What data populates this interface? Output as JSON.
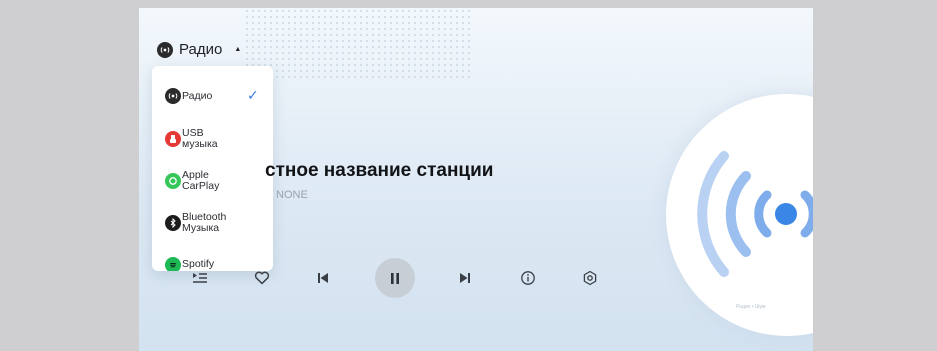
{
  "source_selector": {
    "label": "Радио",
    "icon": "radio-icon"
  },
  "dropdown": {
    "items": [
      {
        "label": "Радио",
        "icon": "radio-icon",
        "icon_color": "#2b2b2b",
        "selected": true
      },
      {
        "label": "USB\nмузыка",
        "icon": "usb-icon",
        "icon_color": "#e53935",
        "selected": false
      },
      {
        "label": "Apple\nCarPlay",
        "icon": "carplay-icon",
        "icon_color": "#35c759",
        "selected": false
      },
      {
        "label": "Bluetooth\nМузыка",
        "icon": "bluetooth-icon",
        "icon_color": "#1c1c1c",
        "selected": false
      },
      {
        "label": "Spotify",
        "icon": "spotify-icon",
        "icon_color": "#1db954",
        "selected": false
      }
    ],
    "check_mark": "✓"
  },
  "station": {
    "name": "стное название станции",
    "subtitle": "NONE"
  },
  "controls": {
    "playlist_icon": "playlist-icon",
    "favorite_icon": "heart-icon",
    "previous_icon": "skip-previous-icon",
    "pause_icon": "pause-icon",
    "next_icon": "skip-next-icon",
    "info_icon": "info-icon",
    "settings_icon": "settings-icon"
  },
  "artwork": {
    "icon": "radio-waves-icon",
    "accent_color": "#3a86e6",
    "caption": "Радио • Шум"
  },
  "colors": {
    "accent": "#3b7be0",
    "pause_button_bg": "#c7ced6"
  }
}
